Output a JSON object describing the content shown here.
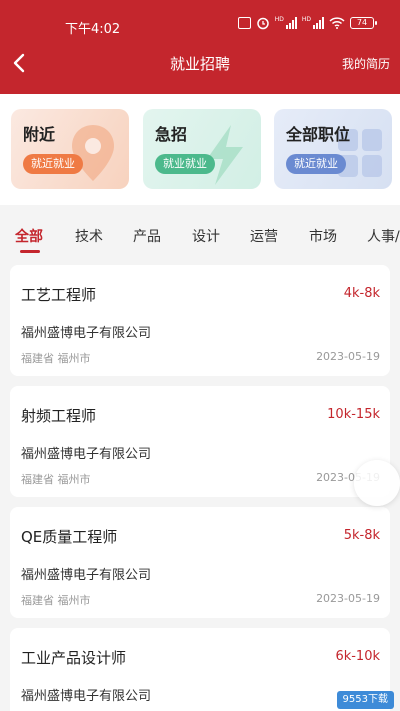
{
  "status_bar": {
    "time": "下午4:02",
    "battery": "74"
  },
  "nav": {
    "title": "就业招聘",
    "right_link": "我的简历"
  },
  "quick_entries": [
    {
      "title": "附近",
      "tag": "就近就业",
      "icon": "location-pin-icon",
      "color": "#ef7a44"
    },
    {
      "title": "急招",
      "tag": "就业就业",
      "icon": "lightning-icon",
      "color": "#4cb98c"
    },
    {
      "title": "全部职位",
      "tag": "就近就业",
      "icon": "grid-icon",
      "color": "#6a8ad1"
    }
  ],
  "tabs": [
    "全部",
    "技术",
    "产品",
    "设计",
    "运营",
    "市场",
    "人事/"
  ],
  "active_tab": "全部",
  "jobs": [
    {
      "title": "工艺工程师",
      "salary": "4k-8k",
      "company": "福州盛博电子有限公司",
      "location": "福建省 福州市",
      "date": "2023-05-19"
    },
    {
      "title": "射频工程师",
      "salary": "10k-15k",
      "company": "福州盛博电子有限公司",
      "location": "福建省 福州市",
      "date": "2023-05-19"
    },
    {
      "title": "QE质量工程师",
      "salary": "5k-8k",
      "company": "福州盛博电子有限公司",
      "location": "福建省 福州市",
      "date": "2023-05-19"
    },
    {
      "title": "工业产品设计师",
      "salary": "6k-10k",
      "company": "福州盛博电子有限公司",
      "location": "",
      "date": ""
    }
  ],
  "watermark": "9553下载",
  "colors": {
    "brand": "#c4262d",
    "salary": "#c4262d",
    "muted": "#999999"
  }
}
